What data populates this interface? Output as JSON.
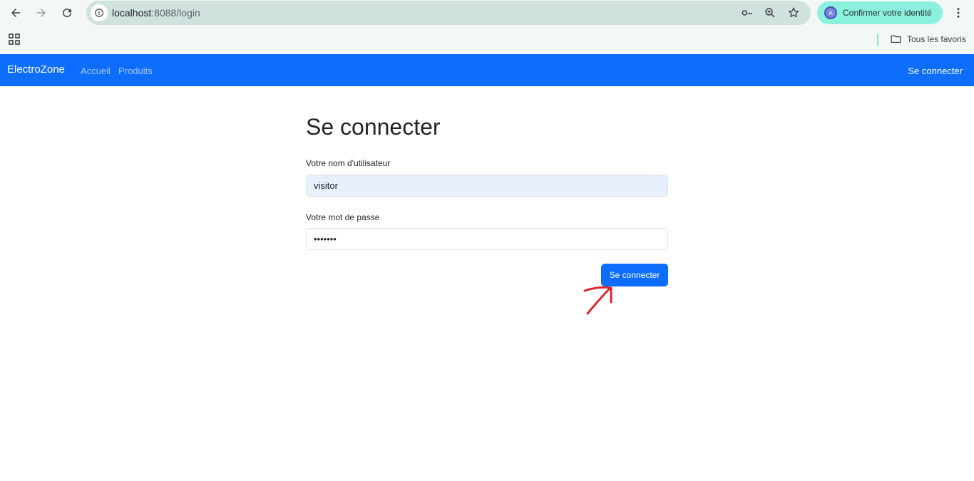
{
  "browser": {
    "url_host": "localhost",
    "url_path": ":8088/login",
    "profile_label": "Confirmer votre identité",
    "profile_initial": "A",
    "bookmarks_folder": "Tous les favoris"
  },
  "navbar": {
    "brand": "ElectroZone",
    "links": [
      "Accueil",
      "Produits"
    ],
    "login_link": "Se connecter",
    "color": "#0d6efd"
  },
  "login": {
    "title": "Se connecter",
    "username_label": "Votre nom d'utilisateur",
    "username_value": "visitor",
    "password_label": "Votre mot de passe",
    "password_value": "•••••••",
    "submit_label": "Se connecter"
  },
  "annotation": {
    "icon": "red-hand-drawn-arrow",
    "color": "#e0242c"
  }
}
